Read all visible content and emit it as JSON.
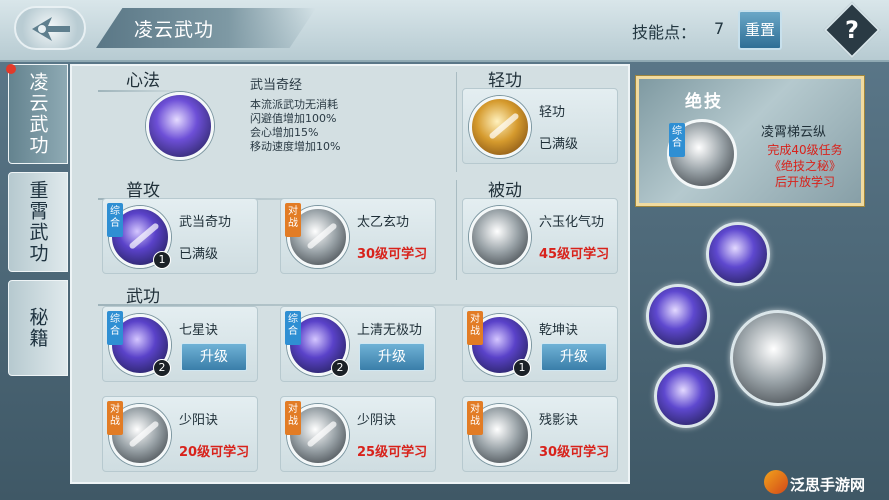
{
  "header": {
    "title": "凌云武功",
    "skill_points_label": "技能点：",
    "skill_points_value": "7",
    "reset_label": "重置",
    "help_label": "?"
  },
  "side_tabs": [
    {
      "label": "凌云武功",
      "active": true
    },
    {
      "label": "重霄武功",
      "active": false
    },
    {
      "label": "秘籍",
      "active": false
    }
  ],
  "sections": {
    "xinfa": "心法",
    "qinggong": "轻功",
    "pugong": "普攻",
    "beidong": "被动",
    "wugong": "武功"
  },
  "xinfa": {
    "name": "武当奇经",
    "lines": [
      "本流派武功无消耗",
      "闪避值增加100%",
      "会心增加15%",
      "移动速度增加10%"
    ]
  },
  "qinggong": {
    "name": "轻功",
    "status": "已满级"
  },
  "pugong": [
    {
      "tag": "综合",
      "name": "武当奇功",
      "status": "已满级",
      "level": "1"
    },
    {
      "tag": "对战",
      "name": "太乙玄功",
      "status": "30级可学习"
    }
  ],
  "beidong": {
    "name": "六玉化气功",
    "status": "45级可学习"
  },
  "wugong": [
    {
      "tag": "综合",
      "name": "七星诀",
      "button": "升级",
      "level": "2"
    },
    {
      "tag": "综合",
      "name": "上清无极功",
      "button": "升级",
      "level": "2"
    },
    {
      "tag": "对战",
      "name": "乾坤诀",
      "button": "升级",
      "level": "1"
    },
    {
      "tag": "对战",
      "name": "少阳诀",
      "status": "20级可学习"
    },
    {
      "tag": "对战",
      "name": "少阴诀",
      "status": "25级可学习"
    },
    {
      "tag": "对战",
      "name": "残影诀",
      "status": "30级可学习"
    }
  ],
  "ultimate": {
    "title": "绝技",
    "tag": "综合",
    "name": "凌霄梯云纵",
    "requirement": [
      "完成40级任务",
      "《绝技之秘》",
      "后开放学习"
    ]
  },
  "watermark": "泛思手游网",
  "colors": {
    "accent_blue": "#3a7ea9",
    "locked_red": "#d8221b",
    "tag_orange": "#e27c25",
    "tag_blue": "#2f8fd3"
  }
}
